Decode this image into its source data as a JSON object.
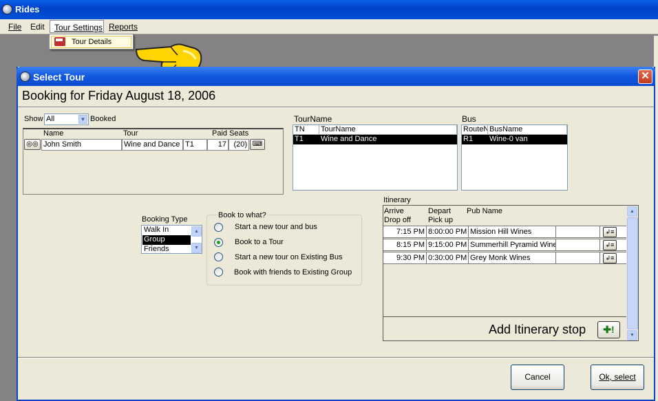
{
  "app": {
    "title": "Rides"
  },
  "menu": {
    "file": "File",
    "edit": "Edit",
    "tour_settings": "Tour Settings",
    "reports": "Reports",
    "tour_settings_dropdown": [
      {
        "label": "Tour Details",
        "icon": "bus-icon"
      }
    ]
  },
  "dialog": {
    "title": "Select Tour",
    "close_label": "✕",
    "heading": "Booking for Friday August 18, 2006",
    "show": {
      "label": "Show",
      "selected": "All",
      "suffix": "Booked"
    },
    "bookings": {
      "columns": [
        "Name",
        "Tour",
        "Paid Seats"
      ],
      "rows": [
        {
          "name": "John Smith",
          "tour": "Wine and Dance",
          "code": "T1",
          "paid": "17",
          "seats": "(20)"
        }
      ]
    },
    "tour_section": {
      "label": "TourName",
      "columns": [
        "TN",
        "TourName"
      ],
      "rows": [
        {
          "tn": "T1",
          "tourname": "Wine and Dance",
          "selected": true
        }
      ]
    },
    "bus_section": {
      "label": "Bus",
      "columns": [
        "RouteN",
        "BusName"
      ],
      "rows": [
        {
          "route": "R1",
          "busname": "Wine-0 van",
          "selected": true
        }
      ]
    },
    "booking_type": {
      "label": "Booking Type",
      "items": [
        "Walk In",
        "Group",
        "Friends"
      ],
      "selected": "Group"
    },
    "book_to_what": {
      "label": "Book to what?",
      "options": [
        "Start a new tour and bus",
        "Book to a Tour",
        "Start a new tour on Existing Bus",
        "Book with friends to Existing Group"
      ],
      "selected": "Book to a Tour"
    },
    "itinerary": {
      "label": "Itinerary",
      "headers": {
        "arrive": "Arrive",
        "drop_off": "Drop off",
        "depart": "Depart",
        "pick_up": "Pick up",
        "pub_name": "Pub Name"
      },
      "rows": [
        {
          "arrive": "7:15 PM",
          "depart": "8:00:00 PM",
          "pub": "Mission Hill Wines"
        },
        {
          "arrive": "8:15 PM",
          "depart": "9:15:00 PM",
          "pub": "Summerhill Pyramid Winery"
        },
        {
          "arrive": "9:30 PM",
          "depart": "0:30:00 PM",
          "pub": "Grey Monk Wines"
        }
      ],
      "add_label": "Add Itinerary stop",
      "add_button": "✚!"
    },
    "buttons": {
      "cancel": "Cancel",
      "ok": "Ok, select"
    }
  }
}
